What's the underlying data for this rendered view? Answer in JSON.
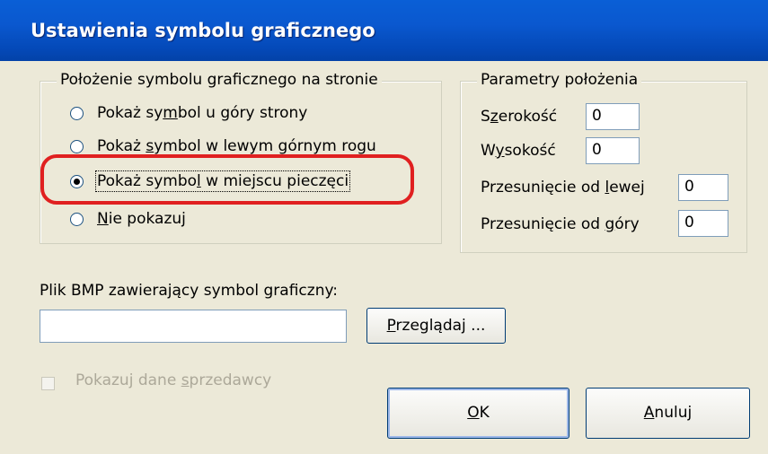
{
  "window": {
    "title": "Ustawienia symbolu graficznego"
  },
  "position_group": {
    "legend": "Położenie symbolu graficznego na stronie",
    "options": [
      {
        "pre": "Pokaż sy",
        "key": "m",
        "post": "bol u góry strony",
        "checked": false
      },
      {
        "pre": "Pokaż ",
        "key": "s",
        "post": "ymbol w lewym górnym rogu",
        "checked": false
      },
      {
        "pre": "Pokaż symbo",
        "key": "l",
        "post": " w miejscu pieczęci",
        "checked": true
      },
      {
        "pre": "",
        "key": "N",
        "post": "ie pokazuj",
        "checked": false
      }
    ]
  },
  "params_group": {
    "legend": "Parametry położenia",
    "width": {
      "pre": "S",
      "key": "z",
      "post": "erokość",
      "value": "0"
    },
    "height": {
      "pre": "W",
      "key": "y",
      "post": "sokość",
      "value": "0"
    },
    "left": {
      "pre": "Przesunięcie od ",
      "key": "l",
      "post": "ewej",
      "value": "0"
    },
    "top": {
      "pre": "Przesunięcie od ",
      "key": "g",
      "post": "óry",
      "value": "0"
    }
  },
  "bmp": {
    "label": "Plik BMP zawierający symbol graficzny:",
    "value": "",
    "browse": {
      "key": "P",
      "post": "rzeglądaj ..."
    }
  },
  "seller_checkbox": {
    "pre": "Pokazuj dane ",
    "key": "s",
    "post": "przedawcy",
    "checked": false,
    "disabled": true
  },
  "buttons": {
    "ok": {
      "key": "O",
      "post": "K"
    },
    "cancel": {
      "key": "A",
      "post": "nuluj"
    }
  },
  "colors": {
    "titlebar": "#0a58cf",
    "dialog_bg": "#ece9d8",
    "highlight": "#e02020"
  }
}
